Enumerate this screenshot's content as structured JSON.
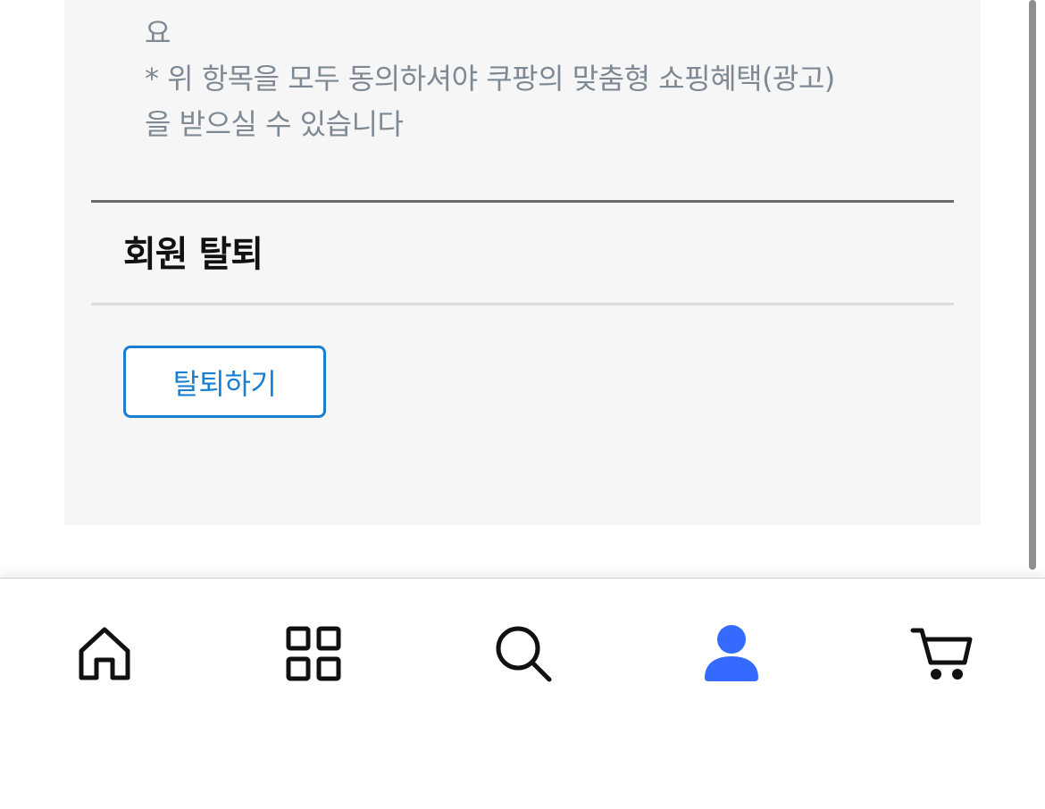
{
  "notice": {
    "lines": [
      "요",
      "* 위 항목을 모두 동의하셔야 쿠팡의 맞춤형 쇼핑혜택(광고)",
      "을 받으실 수 있습니다"
    ]
  },
  "withdrawal": {
    "section_title": "회원 탈퇴",
    "button_label": "탈퇴하기"
  },
  "bottom_nav": {
    "items": [
      {
        "name": "home",
        "icon": "home-icon",
        "active": false
      },
      {
        "name": "categories",
        "icon": "grid-icon",
        "active": false
      },
      {
        "name": "search",
        "icon": "search-icon",
        "active": false
      },
      {
        "name": "my-account",
        "icon": "user-icon",
        "active": true
      },
      {
        "name": "cart",
        "icon": "cart-icon",
        "active": false
      }
    ],
    "active_color": "#346aff",
    "inactive_color": "#111111"
  },
  "colors": {
    "panel_background": "#f6f6f7",
    "notice_text": "#7e8994",
    "button_accent": "#1a7fd1"
  }
}
